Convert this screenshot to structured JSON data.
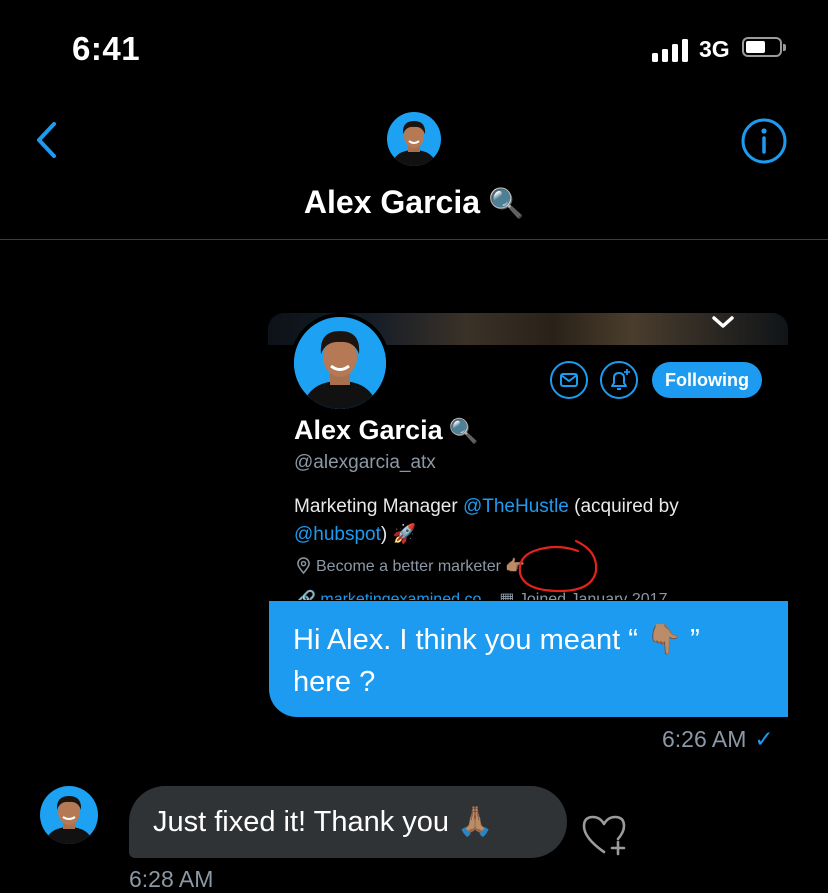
{
  "status_bar": {
    "time": "6:41",
    "network": "3G",
    "battery_level": 0.55
  },
  "header": {
    "back_icon": "chevron-left-icon",
    "info_icon": "info-circle-icon",
    "name": "Alex Garcia",
    "name_emoji": "🔍"
  },
  "profile_card": {
    "name": "Alex Garcia",
    "name_emoji": "🔍",
    "handle": "@alexgarcia_atx",
    "follow_label": "Following",
    "bio_text_1": "Marketing Manager ",
    "bio_link_1": "@TheHustle",
    "bio_text_2": " (acquired by ",
    "bio_link_2": "@hubspot",
    "bio_text_3": ") 🚀",
    "location": "Become a better marketer",
    "location_emoji": "👉🏽",
    "website_partial": "marketingexamined.co",
    "joined_partial": "Joined January 2017",
    "accent": "#1d9bf0",
    "annotation_color": "#e0241b"
  },
  "messages": {
    "outgoing": {
      "text_1": "Hi Alex. I think you meant “ ",
      "emoji": "👇🏽",
      "text_2": " ”",
      "text_3": "here ?",
      "timestamp": "6:26 AM",
      "status": "✓"
    },
    "incoming": {
      "text": "Just fixed it! Thank you ",
      "emoji": "🙏🏽",
      "timestamp": "6:28 AM"
    }
  },
  "colors": {
    "background": "#000000",
    "bubble_out": "#1d9bf0",
    "bubble_in": "#2f3336",
    "muted_text": "#8b98a5"
  }
}
